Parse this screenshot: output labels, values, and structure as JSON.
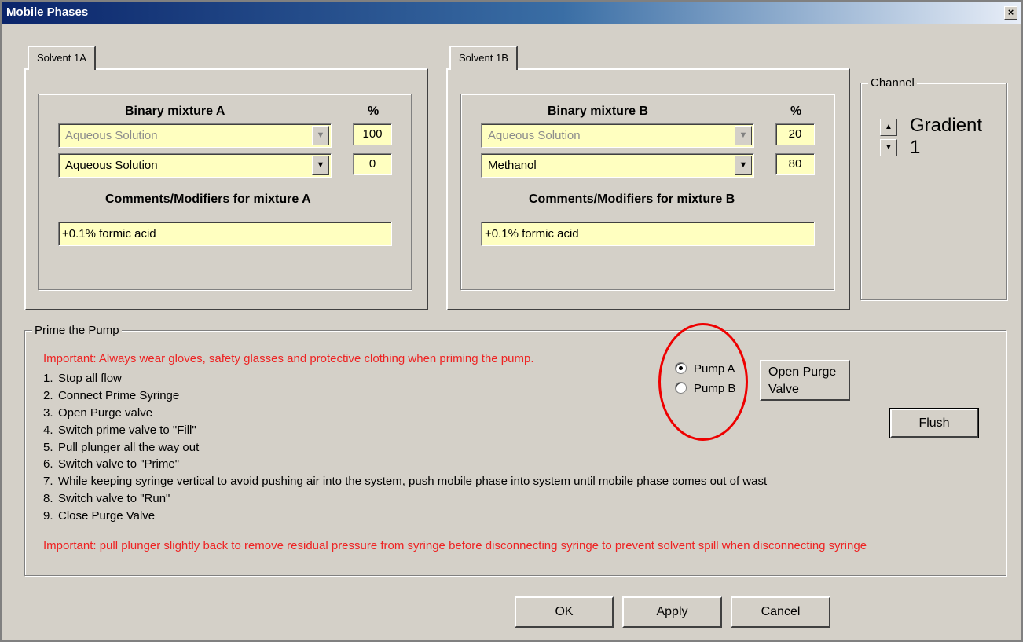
{
  "window": {
    "title": "Mobile Phases",
    "close_glyph": "×"
  },
  "solvent_a": {
    "tab_label": "Solvent 1A",
    "header": "Binary mixture A",
    "percent_header": "%",
    "solvent1": {
      "value": "Aqueous Solution",
      "percent": "100"
    },
    "solvent2": {
      "value": "Aqueous Solution",
      "percent": "0"
    },
    "comments_header": "Comments/Modifiers for mixture A",
    "comments": "+0.1% formic acid"
  },
  "solvent_b": {
    "tab_label": "Solvent 1B",
    "header": "Binary mixture B",
    "percent_header": "%",
    "solvent1": {
      "value": "Aqueous Solution",
      "percent": "20"
    },
    "solvent2": {
      "value": "Methanol",
      "percent": "80"
    },
    "comments_header": "Comments/Modifiers for mixture B",
    "comments": "+0.1% formic acid"
  },
  "channel": {
    "title": "Channel",
    "label": "Gradient",
    "value": "1"
  },
  "prime": {
    "title": "Prime the Pump",
    "warning1": "Important:  Always wear gloves, safety glasses and protective clothing when priming the pump.",
    "steps": [
      {
        "num": "1.",
        "text": "Stop all flow"
      },
      {
        "num": "2.",
        "text": "Connect Prime Syringe"
      },
      {
        "num": "3.",
        "text": "Open Purge valve"
      },
      {
        "num": "4.",
        "text": "Switch prime valve to \"Fill\""
      },
      {
        "num": "5.",
        "text": "Pull plunger all the way out"
      },
      {
        "num": "6.",
        "text": "Switch valve to \"Prime\""
      },
      {
        "num": "7.",
        "text": "While keeping syringe vertical to avoid pushing air into the system, push mobile phase into system until mobile phase comes out of wast"
      },
      {
        "num": "8.",
        "text": "Switch valve to \"Run\""
      },
      {
        "num": "9.",
        "text": "Close Purge Valve"
      }
    ],
    "warning2": "Important: pull plunger slightly back to remove residual pressure from syringe before disconnecting syringe to prevent solvent spill when disconnecting syringe",
    "pump_a": "Pump A",
    "pump_b": "Pump B",
    "selected_pump": "Pump A",
    "purge_line1": "Open Purge",
    "purge_line2": "Valve",
    "flush": "Flush"
  },
  "footer": {
    "ok": "OK",
    "apply": "Apply",
    "cancel": "Cancel"
  },
  "colors": {
    "field_bg": "#ffffc0",
    "warning": "#ee2222",
    "annotation": "#ee0000",
    "dialog_bg": "#d4d0c8"
  }
}
